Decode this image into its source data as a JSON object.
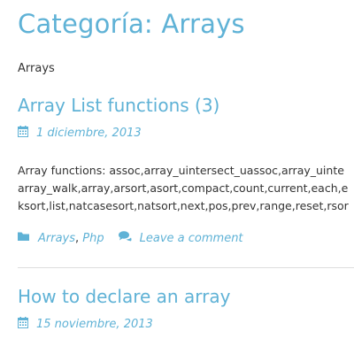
{
  "page": {
    "title": "Categoría: Arrays",
    "description": "Arrays"
  },
  "posts": [
    {
      "title": "Array List functions (3)",
      "date": "1 diciembre, 2013",
      "excerpt_lines": [
        "Array functions: assoc,array_uintersect_uassoc,array_uinte",
        "array_walk,array,arsort,asort,compact,count,current,each,e",
        "ksort,list,natcasesort,natsort,next,pos,prev,range,reset,rsor"
      ],
      "categories": [
        "Arrays",
        "Php"
      ],
      "category_separator": ",",
      "comment_link": "Leave a comment"
    },
    {
      "title": "How to declare an array",
      "date": "15 noviembre, 2013"
    }
  ],
  "colors": {
    "accent": "#5fb2d6",
    "text": "#333333",
    "divider": "#dddddd"
  },
  "icons": [
    "calendar-icon",
    "folder-icon",
    "comments-icon"
  ]
}
